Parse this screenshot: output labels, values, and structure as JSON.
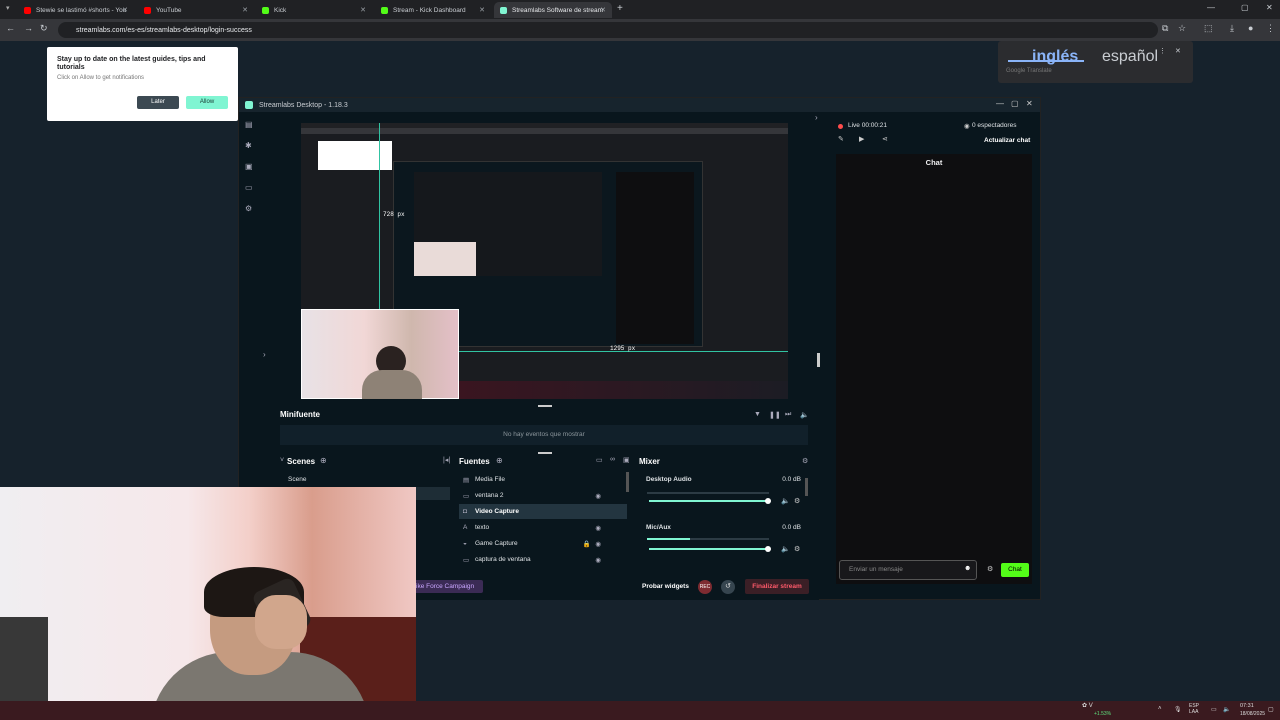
{
  "browser": {
    "tabs": [
      {
        "label": "Stewie se lastimó #shorts - You",
        "color": "#ff0000",
        "active": false
      },
      {
        "label": "YouTube",
        "color": "#ff0000",
        "active": false
      },
      {
        "label": "Kick",
        "color": "#53fc18",
        "active": false
      },
      {
        "label": "Stream - Kick Dashboard",
        "color": "#53fc18",
        "active": false
      },
      {
        "label": "Streamlabs Software de stream",
        "color": "#80f5d2",
        "active": true
      }
    ],
    "url": "streamlabs.com/es-es/streamlabs-desktop/login-success"
  },
  "notification": {
    "title": "Stay up to date on the latest guides, tips and tutorials",
    "subtitle": "Click on Allow to get notifications",
    "later": "Later",
    "allow": "Allow"
  },
  "translate": {
    "lang_active": "inglés",
    "lang_other": "español",
    "provider": "Google Translate"
  },
  "streamlabs": {
    "title": "Streamlabs Desktop - 1.18.3",
    "measure_h": "728 px",
    "measure_w": "1295 px",
    "minifuente": {
      "title": "Minifuente",
      "empty": "No hay eventos que mostrar"
    },
    "scenes": {
      "title": "Scenes",
      "items": [
        "Scene"
      ]
    },
    "sources": {
      "title": "Fuentes",
      "items": [
        "Media File",
        "ventana 2",
        "Video Capture",
        "texto",
        "Game Capture",
        "captura de ventana"
      ]
    },
    "mixer": {
      "title": "Mixer",
      "channels": [
        {
          "name": "Desktop Audio",
          "db": "0.0 dB",
          "level": 0.0
        },
        {
          "name": "Mic/Aux",
          "db": "0.0 dB",
          "level": 0.35
        }
      ]
    },
    "footer": {
      "campaign": "ike Force Campaign",
      "test_widgets": "Probar widgets",
      "rec": "REC",
      "end_stream": "Finalizar stream"
    },
    "chat": {
      "live": "Live 00:00:21",
      "viewers": "0 espectadores",
      "refresh": "Actualizar chat",
      "title": "Chat",
      "placeholder": "Enviar un mensaje",
      "send": "Chat"
    }
  },
  "taskbar": {
    "stock": "+1.53%",
    "lang": "ESP LAA",
    "time": "07:31",
    "date": "18/08/2025"
  }
}
